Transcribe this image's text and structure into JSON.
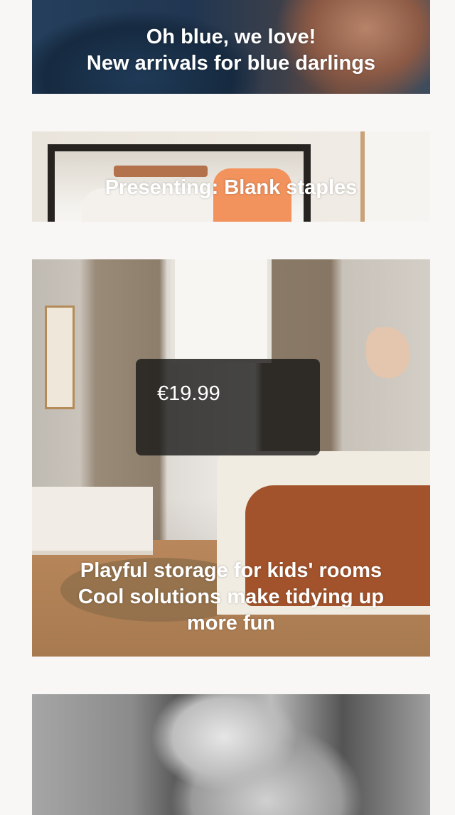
{
  "feed": {
    "cards": [
      {
        "id": "blue",
        "lines": [
          "Oh blue, we love!",
          "New arrivals for blue darlings"
        ]
      },
      {
        "id": "blank",
        "lines": [
          "Presenting: Blank staples"
        ]
      },
      {
        "id": "kids",
        "price": "€19.99",
        "lines": [
          "Playful storage for kids' rooms",
          "Cool solutions make tidying up",
          "more fun"
        ]
      },
      {
        "id": "bw",
        "lines": []
      }
    ]
  }
}
